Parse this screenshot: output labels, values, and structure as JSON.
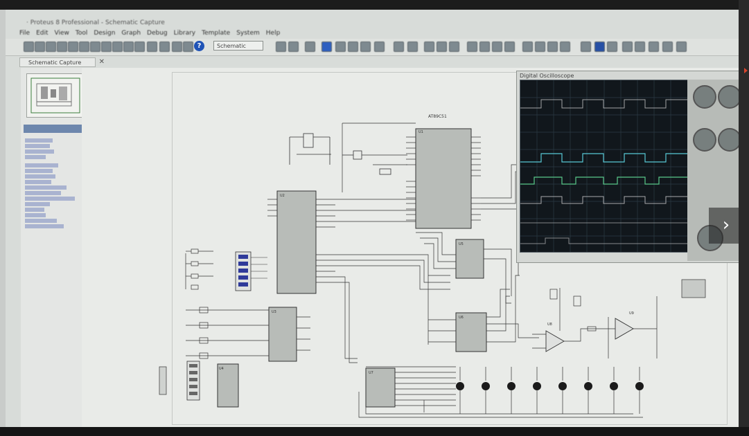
{
  "window": {
    "title": "· Proteus 8 Professional - Schematic Capture"
  },
  "menu": {
    "items": [
      "File",
      "Edit",
      "View",
      "Tool",
      "Design",
      "Graph",
      "Debug",
      "Library",
      "Template",
      "System",
      "Help"
    ]
  },
  "toolbar": {
    "zoom_select": "Schematic"
  },
  "tab": {
    "label": "Schematic Capture",
    "close": "✕"
  },
  "nav": {
    "next": "›"
  },
  "scope": {
    "title": "Digital Oscilloscope"
  },
  "colors": {
    "trace_yellow": "#e4d76b",
    "trace_cyan": "#58c9d6",
    "trace_pink": "#d98fc0",
    "trace_green": "#59c98a",
    "led_dark": "#1b1b1b"
  }
}
